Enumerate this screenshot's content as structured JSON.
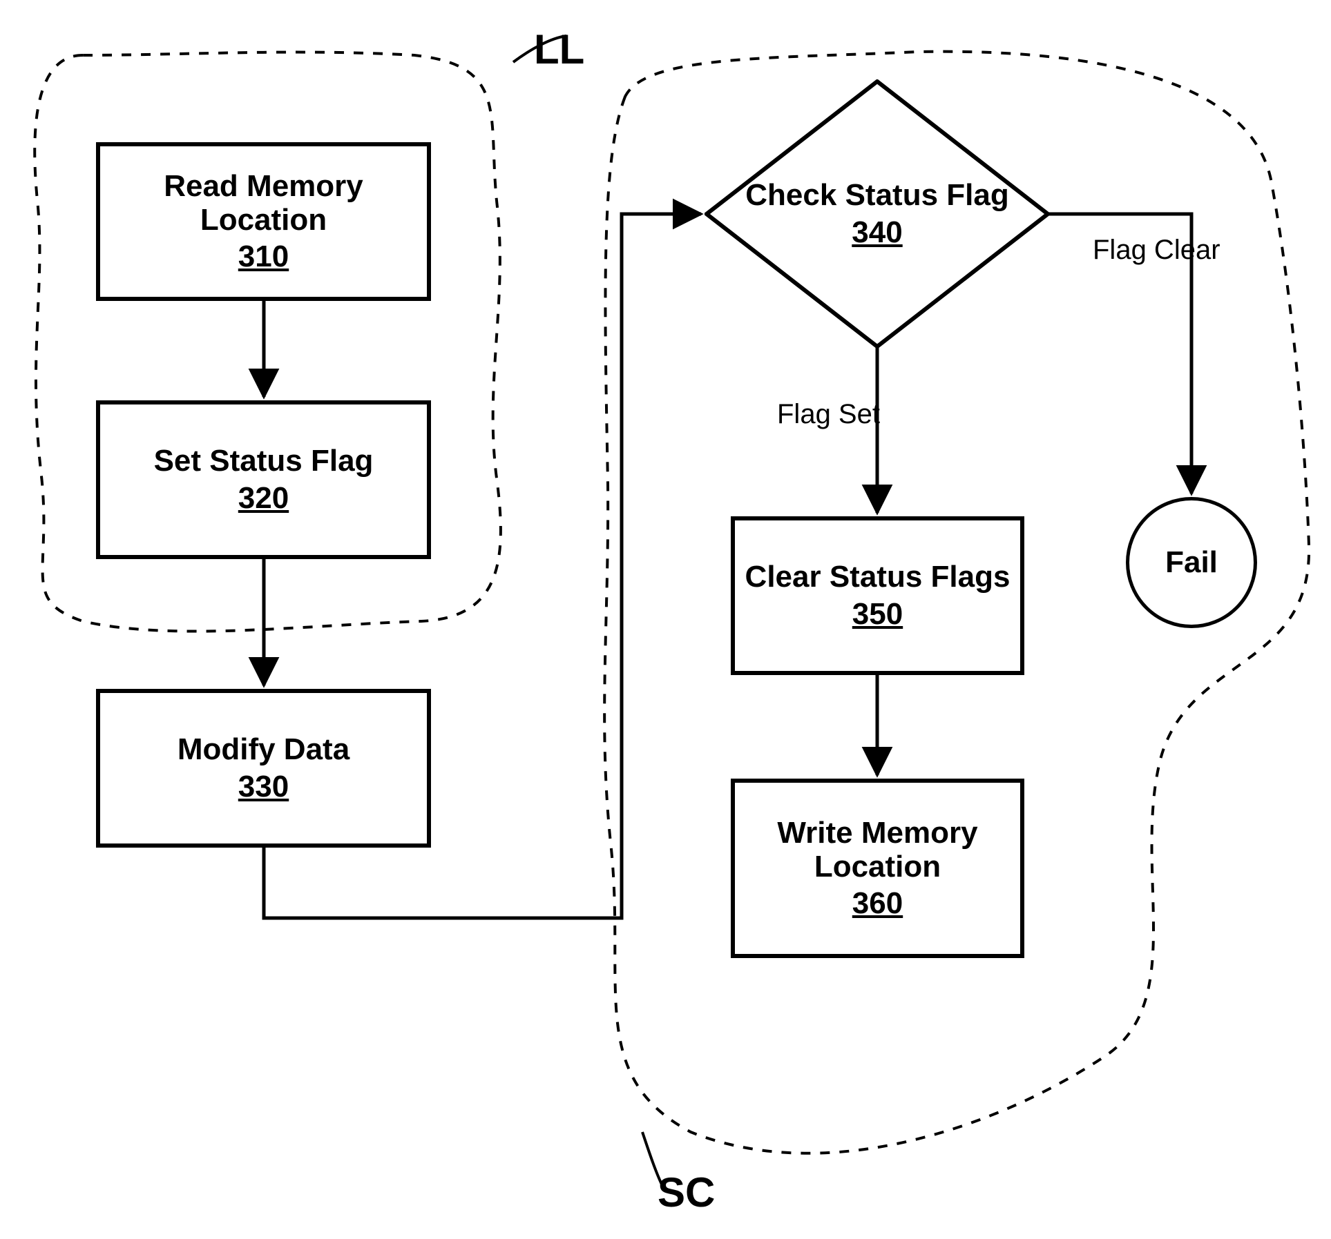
{
  "regions": {
    "ll_label": "LL",
    "sc_label": "SC"
  },
  "nodes": {
    "n310": {
      "title": "Read Memory Location",
      "ref": "310"
    },
    "n320": {
      "title": "Set Status Flag",
      "ref": "320"
    },
    "n330": {
      "title": "Modify Data",
      "ref": "330"
    },
    "n340": {
      "title": "Check Status Flag",
      "ref": "340"
    },
    "n350": {
      "title": "Clear Status Flags",
      "ref": "350"
    },
    "n360": {
      "title": "Write Memory Location",
      "ref": "360"
    },
    "fail": {
      "title": "Fail"
    }
  },
  "edges": {
    "flag_set": "Flag Set",
    "flag_clear": "Flag Clear"
  }
}
